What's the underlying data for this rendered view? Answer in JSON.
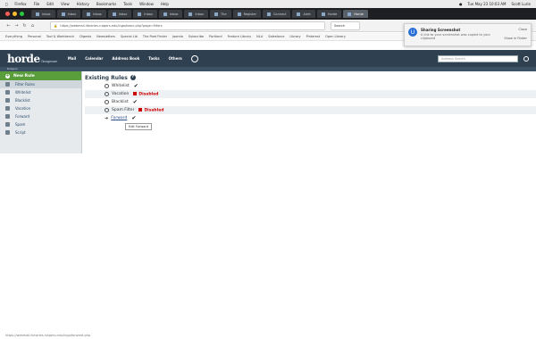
{
  "menubar": {
    "apple": "",
    "items": [
      "Firefox",
      "File",
      "Edit",
      "View",
      "History",
      "Bookmarks",
      "Tools",
      "Window",
      "Help"
    ],
    "clock": "Tue May 23 10:03 AM",
    "user": "Scott Lurie"
  },
  "tabs": [
    {
      "label": "Inbox"
    },
    {
      "label": "Inbox"
    },
    {
      "label": "Inbox"
    },
    {
      "label": "Inbox"
    },
    {
      "label": "Inbox"
    },
    {
      "label": "Inbox"
    },
    {
      "label": "Inbox"
    },
    {
      "label": "The"
    },
    {
      "label": "Register"
    },
    {
      "label": "Connect"
    },
    {
      "label": "Alert"
    },
    {
      "label": "Horde"
    },
    {
      "label": "Horde"
    }
  ],
  "url": "https://webmail.libraries.rutgers.edu/ingo/basic.php?page=filters",
  "search_placeholder": "Search",
  "bookmarks": [
    "Everything",
    "Personal",
    "Tool & Workbench",
    "Digests",
    "Newsletters",
    "Special Lib",
    "The Poet Finder",
    "Joomla",
    "Subscribe",
    "Portland",
    "Feature Library",
    "NLA",
    "Salesforce",
    "Library",
    "Pinterest",
    "Open Library"
  ],
  "notification": {
    "title": "Sharing Screenshot",
    "body": "A link to your screenshot was copied to your clipboard",
    "close": "Close",
    "show": "Show in Finder"
  },
  "horde": {
    "logo": "horde",
    "logo_suffix": "Groupware",
    "menu": [
      "Mail",
      "Calendar",
      "Address Book",
      "Tasks",
      "Others"
    ],
    "search_placeholder": "Address Search",
    "subbar": "Rutgers"
  },
  "sidebar": {
    "new_rule": "New Rule",
    "items": [
      {
        "label": "Filter Rules"
      },
      {
        "label": "Whitelist"
      },
      {
        "label": "Blacklist"
      },
      {
        "label": "Vacation"
      },
      {
        "label": "Forward"
      },
      {
        "label": "Spam"
      },
      {
        "label": "Script"
      }
    ]
  },
  "main": {
    "title": "Existing Rules",
    "rules": [
      {
        "label": "Whitelist",
        "state": "enabled"
      },
      {
        "label": "Vacation",
        "state": "Disabled"
      },
      {
        "label": "Blacklist",
        "state": "enabled"
      },
      {
        "label": "Spam Filter",
        "state": "Disabled"
      },
      {
        "label": "Forward",
        "state": "enabled"
      }
    ],
    "tooltip": "Edit Forward"
  },
  "status": "https://webmail.libraries.rutgers.edu/ingo/forward.php"
}
